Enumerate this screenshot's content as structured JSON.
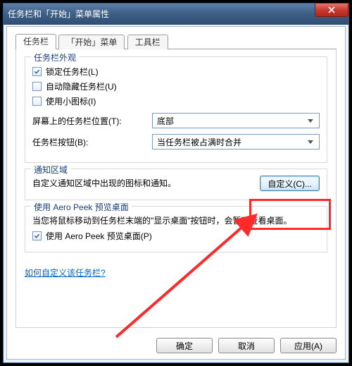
{
  "window": {
    "title": "任务栏和「开始」菜单属性"
  },
  "tabs": {
    "taskbar": "任务栏",
    "start_menu": "「开始」菜单",
    "toolbars": "工具栏"
  },
  "appearance": {
    "legend": "任务栏外观",
    "lock": "锁定任务栏(L)",
    "autohide": "自动隐藏任务栏(U)",
    "small_icons": "使用小图标(I)"
  },
  "position": {
    "label": "屏幕上的任务栏位置(T):",
    "value": "底部"
  },
  "buttons_combine": {
    "label": "任务栏按钮(B):",
    "value": "当任务栏被占满时合并"
  },
  "notification": {
    "legend": "通知区域",
    "desc": "自定义通知区域中出现的图标和通知。",
    "customize": "自定义(C)..."
  },
  "aero": {
    "legend": "使用 Aero Peek 预览桌面",
    "desc": "当您将鼠标移动到任务栏末端的\"显示桌面\"按钮时，会暂时查看桌面。",
    "checkbox": "使用 Aero Peek 预览桌面(P)"
  },
  "help_link": "如何自定义该任务栏?",
  "buttons": {
    "ok": "确定",
    "cancel": "取消",
    "apply": "应用(A)"
  }
}
